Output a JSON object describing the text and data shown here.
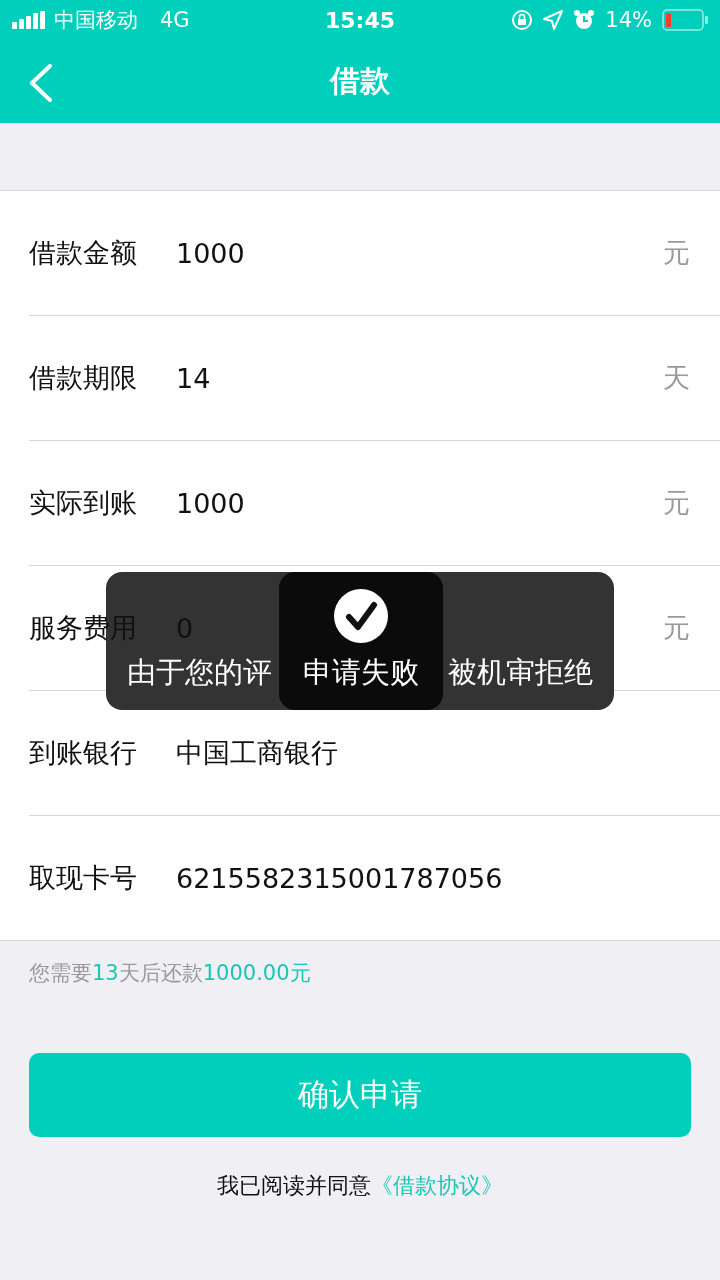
{
  "status_bar": {
    "carrier": "中国移动",
    "network": "4G",
    "time": "15:45",
    "battery": "14%"
  },
  "nav": {
    "title": "借款"
  },
  "form": {
    "rows": [
      {
        "label": "借款金额",
        "value": "1000",
        "unit": "元"
      },
      {
        "label": "借款期限",
        "value": "14",
        "unit": "天"
      },
      {
        "label": "实际到账",
        "value": "1000",
        "unit": "元"
      },
      {
        "label": "服务费用",
        "value": "0",
        "unit": "元"
      },
      {
        "label": "到账银行",
        "value": "中国工商银行"
      },
      {
        "label": "取现卡号",
        "value": "6215582315001787056"
      }
    ]
  },
  "hint": [
    {
      "text": "您需要",
      "highlight": false
    },
    {
      "text": "13",
      "highlight": true
    },
    {
      "text": "天后还款",
      "highlight": false
    },
    {
      "text": "1000.00元",
      "highlight": true
    }
  ],
  "confirm_button": "确认申请",
  "agreement": {
    "text": "我已阅读并同意",
    "link": "《借款协议》"
  },
  "toasts": [
    {
      "text_start": "由于您的评",
      "text_end": "被机审拒绝"
    },
    {
      "text": "申请失败"
    }
  ]
}
